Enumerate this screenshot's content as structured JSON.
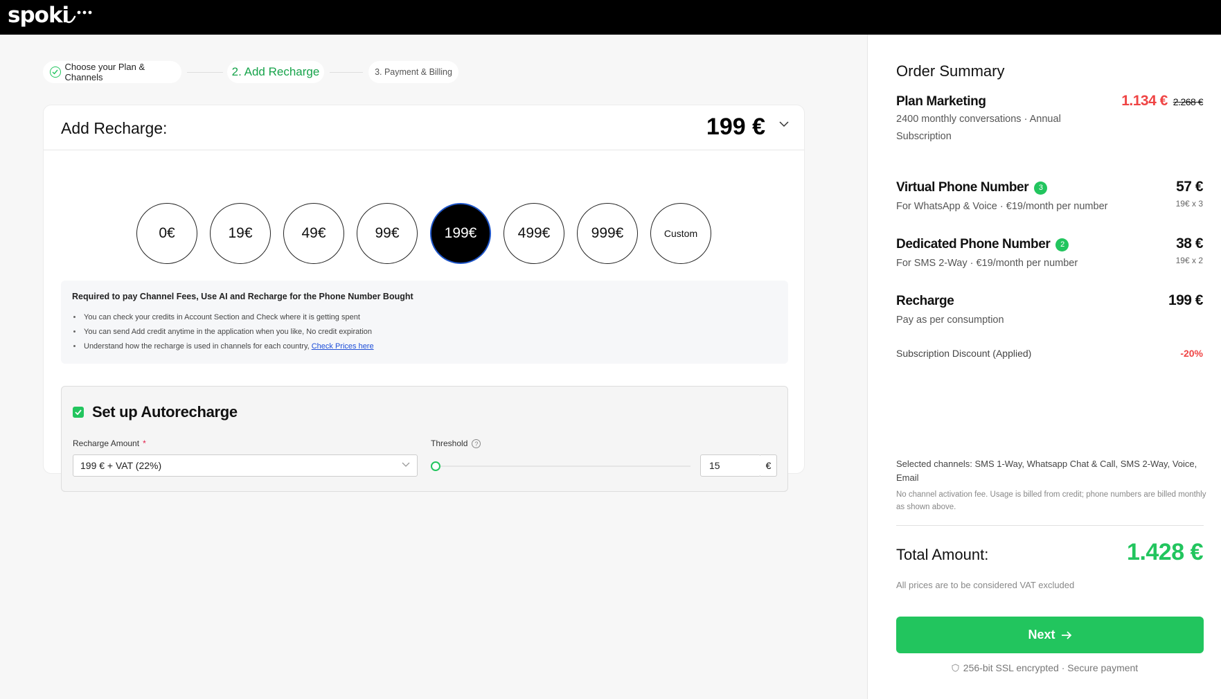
{
  "brand": {
    "logo_text": "spoki"
  },
  "stepper": {
    "step1": "Choose your Plan & Channels",
    "step2": "2. Add Recharge",
    "step3": "3. Payment & Billing"
  },
  "recharge": {
    "title": "Add Recharge:",
    "selected_amount": "199 €",
    "options": [
      "0€",
      "19€",
      "49€",
      "99€",
      "199€",
      "499€",
      "999€",
      "Custom"
    ],
    "selected_index": 4
  },
  "info": {
    "title": "Required to pay Channel Fees, Use AI and Recharge for the Phone Number Bought",
    "items": [
      "You can check your credits in Account Section and Check where it is getting spent",
      "You can send Add credit anytime in the application when you like, No credit expiration",
      "Understand how the recharge is used in channels for each country,"
    ],
    "link_text": "Check Prices here"
  },
  "autorecharge": {
    "title": "Set up Autorecharge",
    "checked": true,
    "amount_label": "Recharge Amount",
    "required_mark": "*",
    "amount_value": "199 € + VAT (22%)",
    "threshold_label": "Threshold",
    "help_glyph": "?",
    "threshold_value": "15",
    "currency": "€",
    "slider_level": 0
  },
  "summary": {
    "title": "Order Summary",
    "plan": {
      "name": "Plan Marketing",
      "desc_line1": "2400 monthly conversations · Annual",
      "desc_line2": "Subscription",
      "price": "1.134 €",
      "old_price": "2.268 €"
    },
    "virtual": {
      "name": "Virtual Phone Number",
      "badge": "3",
      "desc": "For WhatsApp & Voice · €19/month per number",
      "price": "57 €",
      "unit": "19€ x 3"
    },
    "dedicated": {
      "name": "Dedicated Phone Number",
      "badge": "2",
      "desc": "For SMS 2-Way · €19/month per number",
      "price": "38 €",
      "unit": "19€ x 2"
    },
    "recharge": {
      "name": "Recharge",
      "desc": "Pay as per consumption",
      "price": "199 €"
    },
    "discount_label": "Subscription Discount (Applied)",
    "discount_value": "-20%",
    "channels": "Selected channels: SMS 1-Way, Whatsapp Chat & Call, SMS 2-Way, Voice, Email",
    "channels_note": "No channel activation fee. Usage is billed from credit; phone numbers are billed monthly as shown above.",
    "total_label": "Total Amount:",
    "total_value": "1.428 €",
    "vat_note": "All prices are to be considered VAT excluded",
    "next_label": "Next",
    "ssl_text": "256-bit SSL encrypted · Secure payment"
  },
  "colors": {
    "accent_green": "#22c55e",
    "price_red": "#ef4444",
    "selected_border": "#1e55c8",
    "topbar": "#000000"
  }
}
